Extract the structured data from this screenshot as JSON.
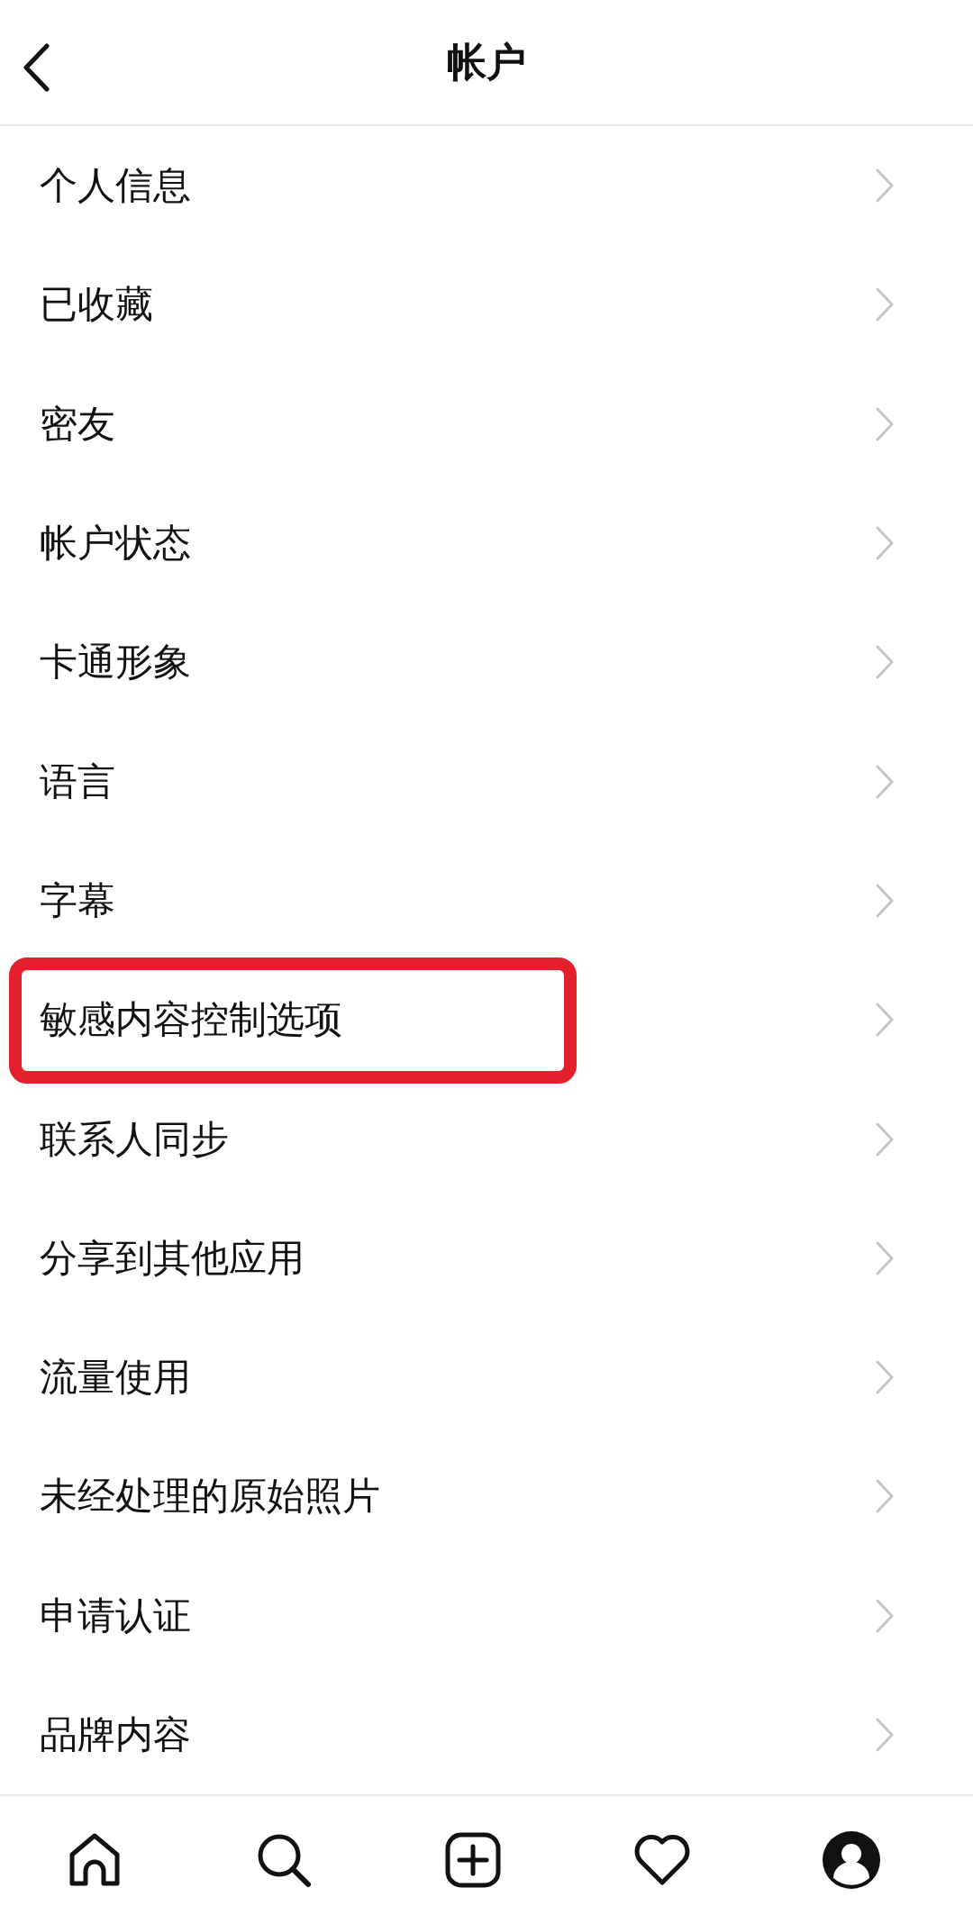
{
  "header": {
    "title": "帐户"
  },
  "items": [
    {
      "label": "个人信息",
      "highlighted": false
    },
    {
      "label": "已收藏",
      "highlighted": false
    },
    {
      "label": "密友",
      "highlighted": false
    },
    {
      "label": "帐户状态",
      "highlighted": false
    },
    {
      "label": "卡通形象",
      "highlighted": false
    },
    {
      "label": "语言",
      "highlighted": false
    },
    {
      "label": "字幕",
      "highlighted": false
    },
    {
      "label": "敏感内容控制选项",
      "highlighted": true
    },
    {
      "label": "联系人同步",
      "highlighted": false
    },
    {
      "label": "分享到其他应用",
      "highlighted": false
    },
    {
      "label": "流量使用",
      "highlighted": false
    },
    {
      "label": "未经处理的原始照片",
      "highlighted": false
    },
    {
      "label": "申请认证",
      "highlighted": false
    },
    {
      "label": "品牌内容",
      "highlighted": false
    }
  ],
  "bottom_nav": [
    {
      "kind": "home",
      "selected": false
    },
    {
      "kind": "search",
      "selected": false
    },
    {
      "kind": "create",
      "selected": false
    },
    {
      "kind": "activity",
      "selected": false
    },
    {
      "kind": "profile",
      "selected": true
    }
  ]
}
